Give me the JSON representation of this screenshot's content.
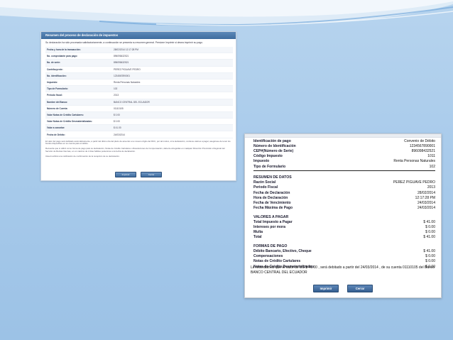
{
  "left_screen": {
    "header_title": "Resumen del proceso de declaración de impuestos",
    "message": "Su declaración ha sido procesada satisfactoriamente, a continuación se presenta su resumen general. Presione Imprimir si desea imprimir su pago.",
    "rows": [
      {
        "label": "Fecha y hora de la transacción:",
        "value": "28/02/2014 12:17:28 PM"
      },
      {
        "label": "No. comprobante para pago:",
        "value": "896098432521"
      },
      {
        "label": "No. de serie:",
        "value": "896098432521"
      },
      {
        "label": "Contribuyente:",
        "value": "PEREZ PIGUAVE PEDRO"
      },
      {
        "label": "No. identificación:",
        "value": "1234567890001"
      },
      {
        "label": "Impuesto:",
        "value": "Renta Personas Naturales"
      },
      {
        "label": "Tipo de Formulario:",
        "value": "102"
      },
      {
        "label": "Periodo fiscal:",
        "value": "2013"
      },
      {
        "label": "Nombre del Banco:",
        "value": "BANCO CENTRAL DEL ECUADOR"
      },
      {
        "label": "Número de Cuenta:",
        "value": "01110105"
      },
      {
        "label": "Valor Notas de Crédito Cartulares:",
        "value": "$ 0.00"
      },
      {
        "label": "Valor Notas de Crédito Desmaterializadas:",
        "value": "$ 0.00"
      },
      {
        "label": "Valor a cancelar:",
        "value": "$ 41.00"
      },
      {
        "label": "Fecha de Débito:",
        "value": "24/03/2014"
      }
    ],
    "para1": "El valor del pago será debitado automáticamente, a partir del último día del plazo de acuerdo a su noveno dígito del RUC, por tal motivo, si la declaración, contiene valores a pagar, asegúrese de tener los fondos disponibles en su cuenta para el débito.",
    "para2": "Recuerde que si utilizó como forma de pago para su declaración, Notas de Crédito Cartulares o Resoluciones de Compensación, deberá entregarlas en cualquier Dirección Provincial o Regional del Servicio de Rentas Internas, en un máximo de 2 días hábiles posteriores a la fecha de declaración.",
    "para3": "Usted recibirá una notificación de confirmación de la recepción de su declaración.",
    "print_label": "Imprimir",
    "close_label": "Cerrar"
  },
  "right_screen": {
    "info_rows": [
      {
        "label": "Identificación de pago",
        "value": "Convenio de Débito"
      },
      {
        "label": "Número de Identificación",
        "value": "1234567890001"
      },
      {
        "label": "CEP#(Número de Serie)",
        "value": "896098432521"
      },
      {
        "label": "Código Impuesto",
        "value": "1011"
      },
      {
        "label": "Impuesto",
        "value": "Renta Personas Naturales"
      },
      {
        "label": "Tipo de Formulario",
        "value": "102"
      }
    ],
    "summary_title": "RESUMEN DE DATOS",
    "summary_rows": [
      {
        "label": "Razón Social",
        "value": "PEREZ PIGUAVE PEDRO"
      },
      {
        "label": "Periodo Fiscal",
        "value": "2013"
      },
      {
        "label": "Fecha de Declaración",
        "value": "28/02/2014"
      },
      {
        "label": "Hora de Declaración",
        "value": "12:17:28 PM"
      },
      {
        "label": "Fecha de Vencimiento",
        "value": "24/03/2014"
      },
      {
        "label": "Fecha Máxima de Pago",
        "value": "24/03/2014"
      }
    ],
    "values_title": "VALORES A PAGAR",
    "values_rows": [
      {
        "label": "Total Impuesto a Pagar",
        "value": "$ 41.00"
      },
      {
        "label": "Intereses por mora",
        "value": "$ 0.00"
      },
      {
        "label": "Multa",
        "value": "$ 0.00"
      },
      {
        "label": "Total",
        "value": "$ 41.00"
      }
    ],
    "payment_title": "FORMAS DE PAGO",
    "payment_rows": [
      {
        "label": "Débito Bancario, Efectivo, Cheque",
        "value": "$ 41.00"
      },
      {
        "label": "Compensaciones",
        "value": "$ 0.00"
      },
      {
        "label": "Notas de Crédito Cartulares",
        "value": "$ 0.00"
      },
      {
        "label": "Notas de Crédito Desmaterializadas",
        "value": "$ 0.00"
      }
    ],
    "notice": "Le recordamos que el valor de US  $ 41.00  , será debitado a partir del 24/03/2014  , de su cuenta 01110105 del Banco BANCO CENTRAL DEL ECUADOR",
    "print_label": "Imprimir",
    "close_label": "Cerrar"
  }
}
